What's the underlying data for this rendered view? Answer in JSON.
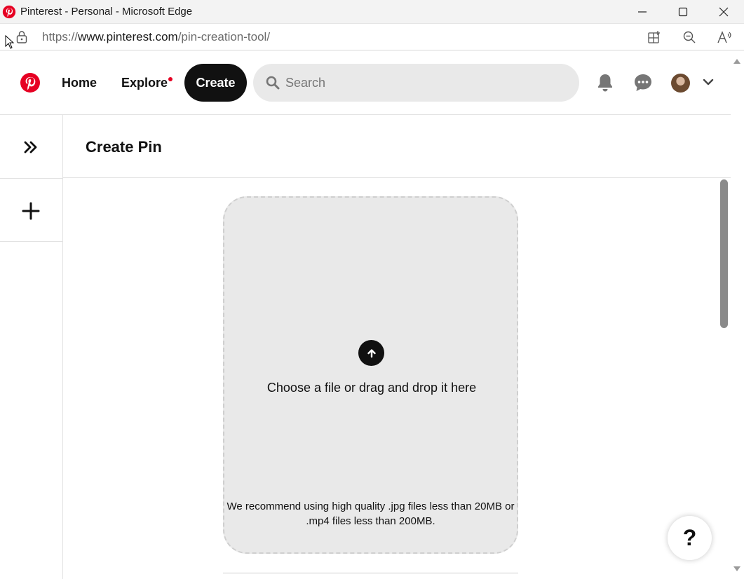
{
  "window": {
    "title": "Pinterest - Personal - Microsoft Edge"
  },
  "address_bar": {
    "url_prefix": "https://",
    "url_host": "www.pinterest.com",
    "url_path": "/pin-creation-tool/"
  },
  "header": {
    "home_label": "Home",
    "explore_label": "Explore",
    "create_label": "Create",
    "search_placeholder": "Search"
  },
  "main": {
    "title": "Create Pin",
    "dropzone_text": "Choose a file or drag and drop it here",
    "dropzone_note": "We recommend using high quality .jpg files less than 20MB or .mp4 files less than 200MB."
  },
  "help": {
    "label": "?"
  },
  "colors": {
    "brand": "#e60023",
    "dark": "#111111",
    "search_bg": "#e9e9e9"
  },
  "icons": [
    "pinterest-logo-icon",
    "lock-icon",
    "split-screen-icon",
    "zoom-out-icon",
    "read-aloud-icon",
    "search-icon",
    "bell-icon",
    "chat-icon",
    "chevron-down-icon",
    "expand-icon",
    "plus-icon",
    "upload-arrow-icon"
  ]
}
